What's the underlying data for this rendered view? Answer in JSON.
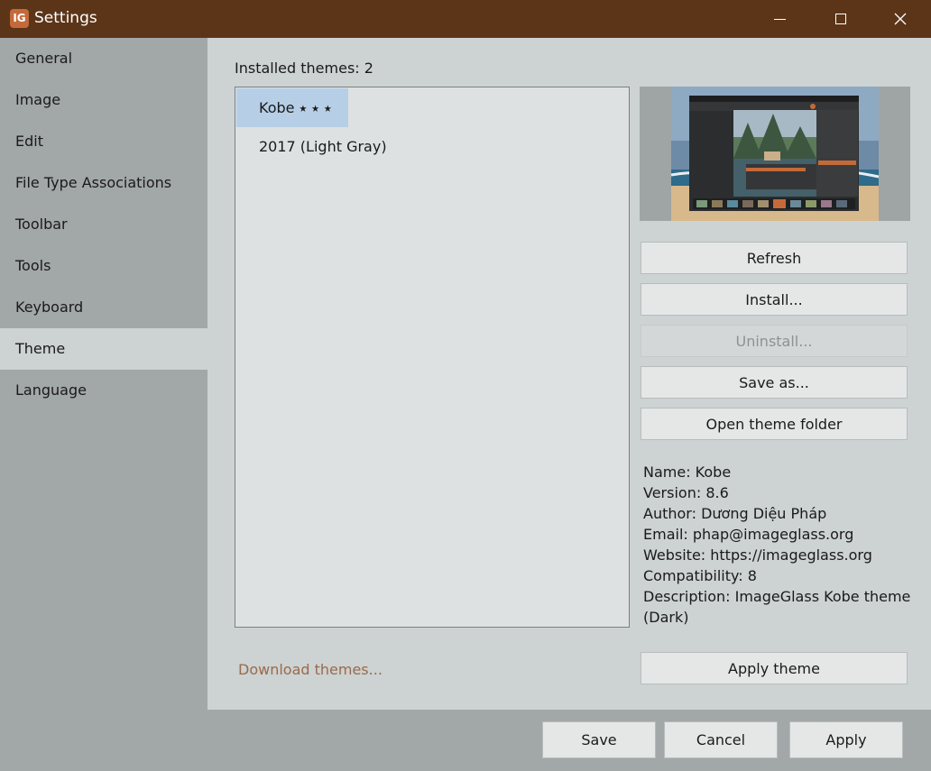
{
  "window": {
    "title": "Settings",
    "icon": "imageglass-app-icon"
  },
  "sidebar": {
    "items": [
      {
        "label": "General"
      },
      {
        "label": "Image"
      },
      {
        "label": "Edit"
      },
      {
        "label": "File Type Associations"
      },
      {
        "label": "Toolbar"
      },
      {
        "label": "Tools"
      },
      {
        "label": "Keyboard"
      },
      {
        "label": "Theme",
        "active": true
      },
      {
        "label": "Language"
      }
    ]
  },
  "theme_panel": {
    "installed_label": "Installed themes: 2",
    "themes": [
      {
        "label": "Kobe ⭑ ⭑ ⭑",
        "selected": true
      },
      {
        "label": "2017 (Light Gray)"
      }
    ],
    "buttons": {
      "refresh": "Refresh",
      "install": "Install...",
      "uninstall": "Uninstall...",
      "save_as": "Save as...",
      "open_folder": "Open theme folder",
      "apply_theme": "Apply theme"
    },
    "info": {
      "name": "Name: Kobe",
      "version": "Version: 8.6",
      "author": "Author: Dương Diệu Pháp",
      "email": "Email: phap@imageglass.org",
      "website": "Website: https://imageglass.org",
      "compatibility": "Compatibility: 8",
      "description_line1": "Description: ImageGlass Kobe theme",
      "description_line2": "(Dark)"
    },
    "download_link": "Download themes..."
  },
  "footer": {
    "save": "Save",
    "cancel": "Cancel",
    "apply": "Apply"
  },
  "colors": {
    "titlebar": "#5c3519",
    "sidebar": "#a2a7a8",
    "content": "#cdd2d2",
    "selected_item": "#b6cfe6",
    "link": "#9a6a4c"
  }
}
